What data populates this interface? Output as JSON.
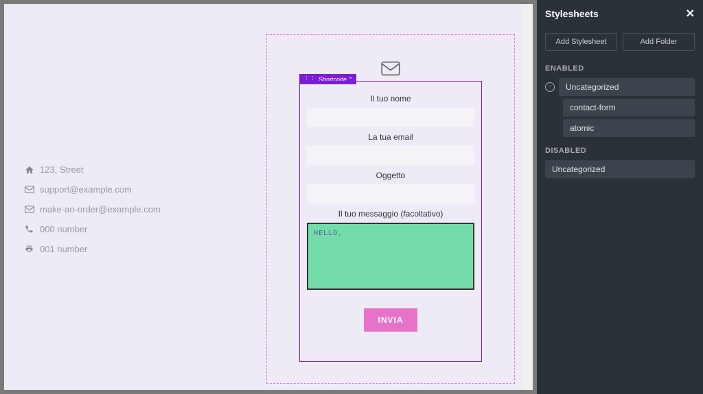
{
  "contact": {
    "address": "123, Street",
    "support_email": "support@example.com",
    "order_email": "make-an-order@example.com",
    "phone": "000 number",
    "fax": "001 number"
  },
  "shortcode_badge": "Shortcode",
  "form": {
    "name_label": "Il tuo nome",
    "email_label": "La tua email",
    "subject_label": "Oggetto",
    "message_label": "Il tuo messaggio (facoltativo)",
    "message_value": "Hello,",
    "submit_label": "INVIA"
  },
  "panel": {
    "title": "Stylesheets",
    "add_stylesheet": "Add Stylesheet",
    "add_folder": "Add Folder",
    "enabled_label": "ENABLED",
    "disabled_label": "DISABLED",
    "enabled_group": "Uncategorized",
    "enabled_items": [
      "contact-form",
      "atomic"
    ],
    "disabled_group": "Uncategorized"
  }
}
